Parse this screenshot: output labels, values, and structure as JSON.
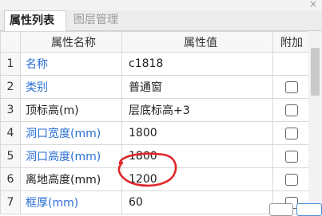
{
  "window": {
    "close_glyph": "×"
  },
  "tabs": [
    {
      "label": "属性列表",
      "active": true
    },
    {
      "label": "图层管理",
      "active": false
    }
  ],
  "table": {
    "headers": {
      "index": "",
      "name": "属性名称",
      "value": "属性值",
      "add": "附加"
    },
    "rows": [
      {
        "index": "1",
        "name": "名称",
        "value": "c1818",
        "name_color": "blue",
        "checkbox": false
      },
      {
        "index": "2",
        "name": "类别",
        "value": "普通窗",
        "name_color": "blue",
        "checkbox": true
      },
      {
        "index": "3",
        "name": "顶标高(m)",
        "value": "层底标高+3",
        "name_color": "dark",
        "checkbox": true
      },
      {
        "index": "4",
        "name": "洞口宽度(mm)",
        "value": "1800",
        "name_color": "blue",
        "checkbox": true
      },
      {
        "index": "5",
        "name": "洞口高度(mm)",
        "value": "1800",
        "name_color": "blue",
        "checkbox": true
      },
      {
        "index": "6",
        "name": "离地高度(mm)",
        "value": "1200",
        "name_color": "dark",
        "checkbox": true
      },
      {
        "index": "7",
        "name": "框厚(mm)",
        "value": "60",
        "name_color": "blue",
        "checkbox": true
      }
    ]
  },
  "colors": {
    "blue_label": "#2a6fd4",
    "annotation_red": "#e0262a"
  },
  "annotation": {
    "shape": "red hand-drawn circle",
    "target": "row 6 value"
  }
}
